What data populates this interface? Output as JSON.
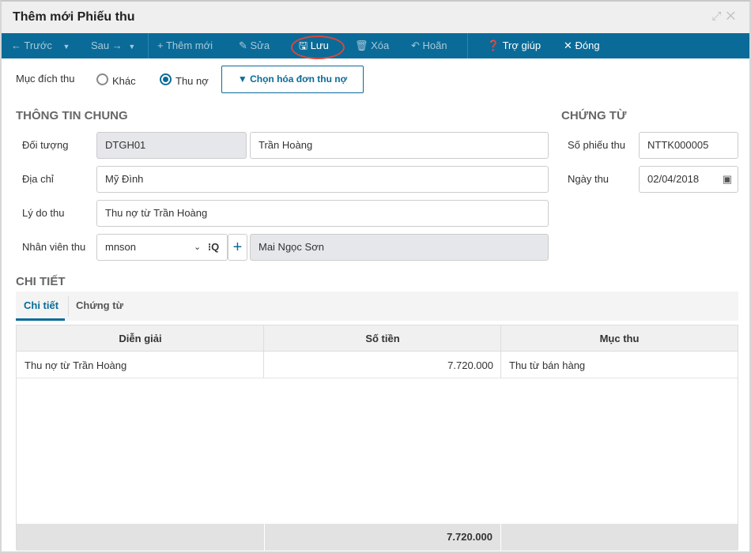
{
  "window": {
    "title": "Thêm mới Phiếu thu"
  },
  "toolbar": {
    "prev": "Trước",
    "next": "Sau",
    "add": "Thêm mới",
    "edit": "Sửa",
    "save": "Lưu",
    "delete": "Xóa",
    "undo": "Hoãn",
    "help": "Trợ giúp",
    "close": "Đóng"
  },
  "purpose": {
    "label": "Mục đích thu",
    "opt_other": "Khác",
    "opt_debt": "Thu nợ",
    "selected": "Thu nợ",
    "choose_invoice": "Chọn hóa đơn thu nợ"
  },
  "general": {
    "heading": "THÔNG TIN CHUNG",
    "object_label": "Đối tượng",
    "object_code": "DTGH01",
    "object_name": "Trần Hoàng",
    "address_label": "Địa chỉ",
    "address": "Mỹ Đình",
    "reason_label": "Lý do thu",
    "reason": "Thu nợ từ Trần Hoàng",
    "staff_label": "Nhân viên thu",
    "staff_code": "mnson",
    "staff_name": "Mai Ngọc Sơn"
  },
  "voucher": {
    "heading": "CHỨNG TỪ",
    "number_label": "Số phiếu thu",
    "number": "NTTK000005",
    "date_label": "Ngày thu",
    "date": "02/04/2018"
  },
  "detail": {
    "heading": "CHI TIẾT",
    "tabs": [
      "Chi tiết",
      "Chứng từ"
    ],
    "columns": [
      "Diễn giải",
      "Số tiền",
      "Mục thu"
    ],
    "rows": [
      {
        "desc": "Thu nợ từ Trần Hoàng",
        "amount": "7.720.000",
        "category": "Thu từ bán hàng"
      }
    ],
    "total": "7.720.000"
  }
}
